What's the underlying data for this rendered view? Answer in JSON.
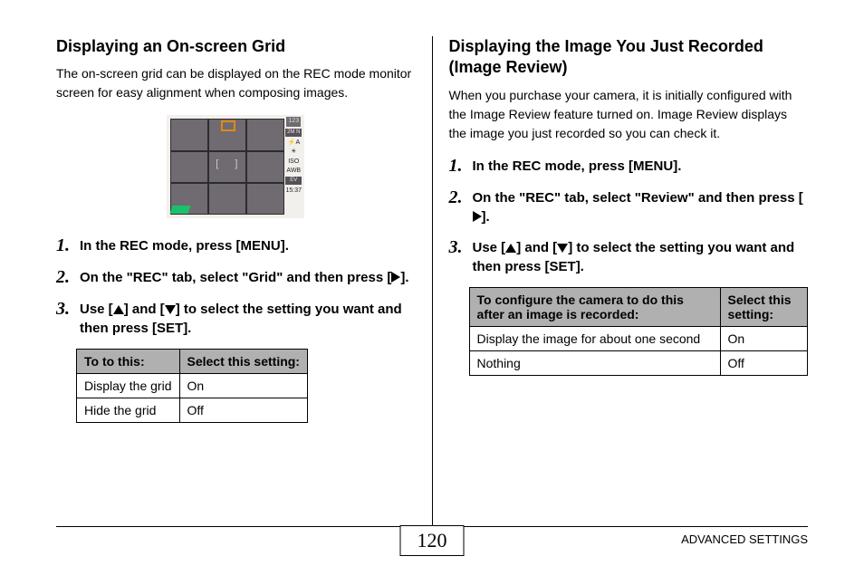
{
  "left": {
    "heading": "Displaying an On-screen Grid",
    "intro": "The on-screen grid can be displayed on the REC mode monitor screen for easy alignment when composing images.",
    "screen_side": {
      "count": "123",
      "badges": [
        "2M N",
        "⚡A",
        "☀",
        "ISO",
        "AWB",
        "EV",
        "15:37"
      ]
    },
    "steps": {
      "s1": "In the REC mode, press [MENU].",
      "s2a": "On the \"REC\" tab, select \"Grid\" and then press [",
      "s2b": "].",
      "s3a": "Use [",
      "s3b": "] and [",
      "s3c": "] to select the setting you want and then press [SET]."
    },
    "table": {
      "h1": "To to this:",
      "h2": "Select this setting:",
      "r1c1": "Display the grid",
      "r1c2": "On",
      "r2c1": "Hide the grid",
      "r2c2": "Off"
    }
  },
  "right": {
    "heading": "Displaying the Image You Just Recorded (Image Review)",
    "intro": "When you purchase your camera, it is initially configured with the Image Review feature turned on. Image Review displays the image you just recorded so you can check it.",
    "steps": {
      "s1": "In the REC mode, press [MENU].",
      "s2a": "On the \"REC\" tab, select \"Review\" and then press [",
      "s2b": "].",
      "s3a": "Use [",
      "s3b": "] and [",
      "s3c": "] to select the setting you want and then press [SET]."
    },
    "table": {
      "h1": "To configure the camera to do this after an image is recorded:",
      "h2": "Select this setting:",
      "r1c1": "Display the image for about one second",
      "r1c2": "On",
      "r2c1": "Nothing",
      "r2c2": "Off"
    }
  },
  "footer": {
    "page": "120",
    "section": "ADVANCED SETTINGS"
  }
}
